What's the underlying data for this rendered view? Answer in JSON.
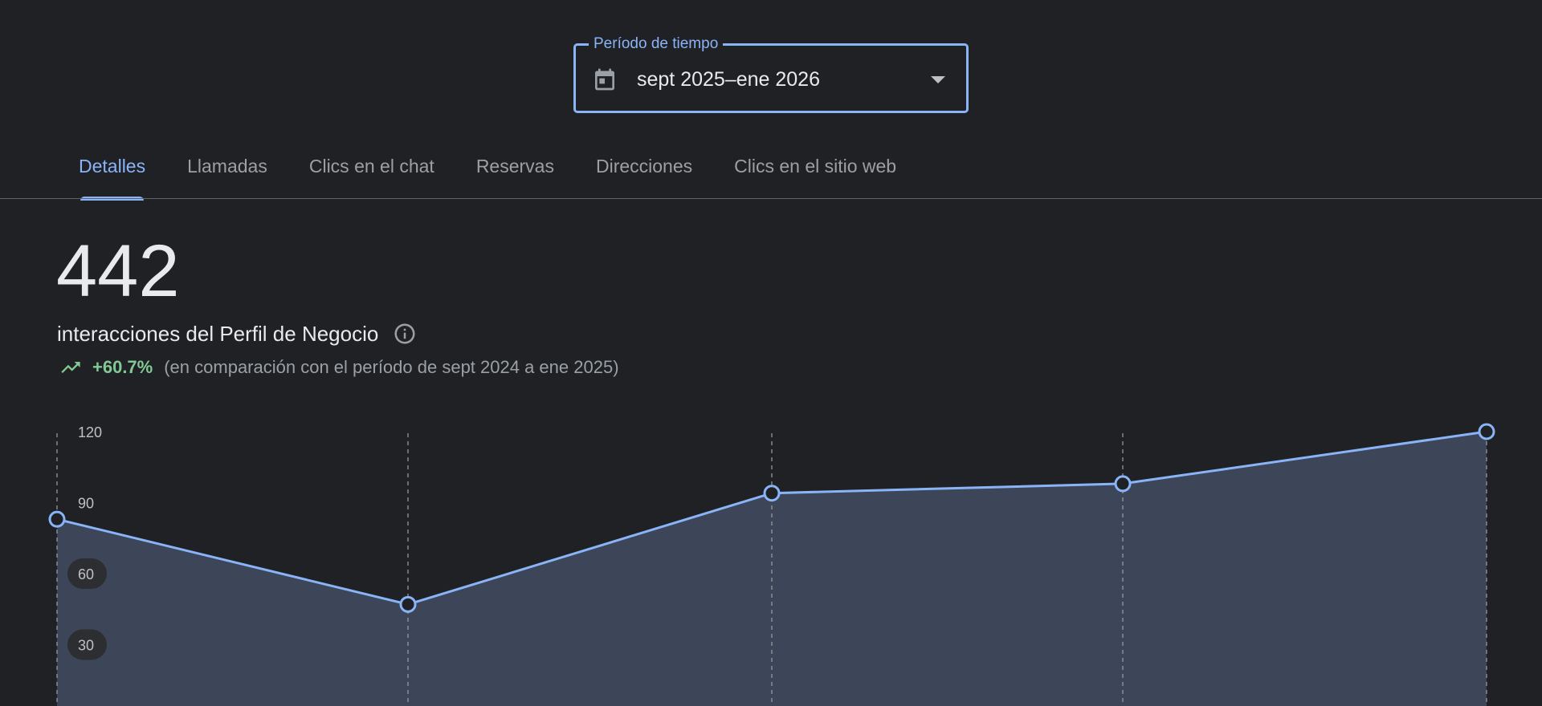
{
  "period_selector": {
    "legend": "Período de tiempo",
    "value": "sept 2025–ene 2026",
    "icon": "calendar-icon"
  },
  "tabs": [
    {
      "label": "Detalles",
      "active": true
    },
    {
      "label": "Llamadas",
      "active": false
    },
    {
      "label": "Clics en el chat",
      "active": false
    },
    {
      "label": "Reservas",
      "active": false
    },
    {
      "label": "Direcciones",
      "active": false
    },
    {
      "label": "Clics en el sitio web",
      "active": false
    }
  ],
  "summary": {
    "total": "442",
    "label": "interacciones del Perfil de Negocio",
    "change": "+60.7%",
    "comparison": "(en comparación con el período de sept 2024 a ene 2025)"
  },
  "colors": {
    "accent": "#8ab4f8",
    "positive": "#81c995",
    "background": "#202124",
    "area_fill": "#3c4658"
  },
  "chart_data": {
    "type": "area",
    "y_ticks": [
      120,
      90,
      60,
      30
    ],
    "ylim": [
      0,
      120
    ],
    "x": [
      "",
      "",
      "",
      "",
      ""
    ],
    "series": [
      {
        "values": [
          83,
          47,
          94,
          98,
          120
        ]
      }
    ]
  }
}
